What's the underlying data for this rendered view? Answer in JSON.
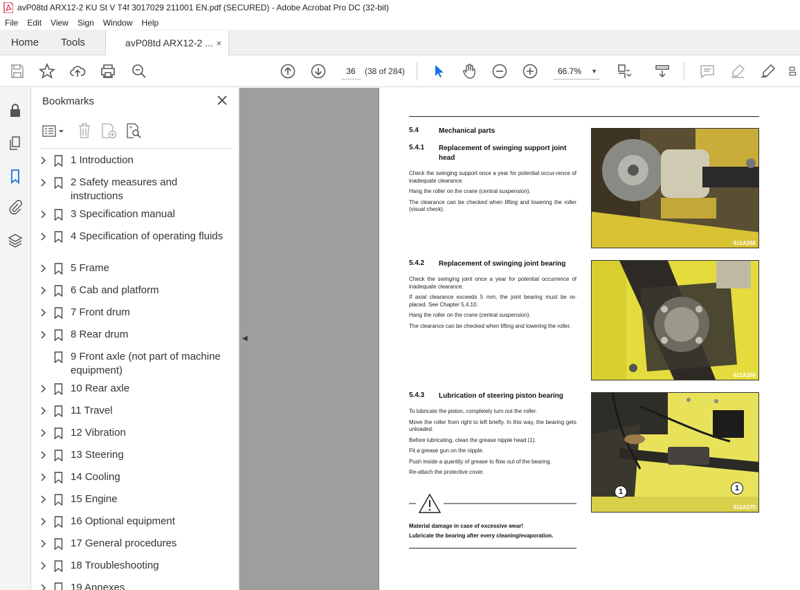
{
  "window": {
    "title": "avP08td ARX12-2 KU St V T4f 3017029 211001 EN.pdf (SECURED) - Adobe Acrobat Pro DC (32-bit)"
  },
  "menu": [
    "File",
    "Edit",
    "View",
    "Sign",
    "Window",
    "Help"
  ],
  "tabs": {
    "home": "Home",
    "tools": "Tools",
    "document": "avP08td ARX12-2 ...",
    "close": "×"
  },
  "toolbar": {
    "page_value": "36",
    "page_count": "(38 of 284)",
    "zoom": "66.7%"
  },
  "bookmarks": {
    "title": "Bookmarks",
    "items": [
      {
        "label": "1 Introduction",
        "expandable": true
      },
      {
        "label": "2 Safety measures and instructions",
        "expandable": true
      },
      {
        "label": "3 Specification manual",
        "expandable": true
      },
      {
        "label": "4 Specification of operating fluids",
        "expandable": true
      },
      {
        "label": "5 Frame",
        "expandable": true
      },
      {
        "label": "6 Cab and platform",
        "expandable": true
      },
      {
        "label": "7 Front drum",
        "expandable": true
      },
      {
        "label": "8 Rear drum",
        "expandable": true
      },
      {
        "label": "9 Front axle (not part of machine equipment)",
        "expandable": false
      },
      {
        "label": "10 Rear axle",
        "expandable": true
      },
      {
        "label": "11 Travel",
        "expandable": true
      },
      {
        "label": "12 Vibration",
        "expandable": true
      },
      {
        "label": "13 Steering",
        "expandable": true
      },
      {
        "label": "14 Cooling",
        "expandable": true
      },
      {
        "label": "15 Engine",
        "expandable": true
      },
      {
        "label": "16 Optional equipment",
        "expandable": true
      },
      {
        "label": "17 General procedures",
        "expandable": true
      },
      {
        "label": "18 Troubleshooting",
        "expandable": true
      },
      {
        "label": "19 Annexes",
        "expandable": true
      }
    ]
  },
  "document": {
    "sections": [
      {
        "num": "5.4",
        "title": "Mechanical parts"
      },
      {
        "num": "5.4.1",
        "title": "Replacement of swinging support joint head"
      },
      {
        "num": "5.4.2",
        "title": "Replacement of swinging joint bearing"
      },
      {
        "num": "5.4.3",
        "title": "Lubrication of steering piston bearing"
      }
    ],
    "text_541": [
      "Check the swinging support once a year for potential occur-rence of inadequate clearance.",
      "Hang the roller on the crane (central suspension).",
      "The clearance can be checked when lifting and lowering the roller (visual check)."
    ],
    "text_542": [
      "Check the swinging joint once a year for potential occurrence of inadequate clearance.",
      "If axial clearance exceeds 5 mm, the joint bearing must be re-placed. See Chapter 5.4.10.",
      "Hang the roller on the crane (central suspension).",
      "The clearance can be checked when lifting and lowering the roller."
    ],
    "text_543": [
      "To lubricate the piston, completely turn out the roller.",
      "Move the roller from right to left briefly. In this way, the bearing gets unloaded.",
      "Before lubricating, clean the grease nipple head (1).",
      "Fit a grease gun on the nipple.",
      "Push inside a quantity of grease to flow out of the bearing.",
      "Re-attach the protective cover."
    ],
    "warning": {
      "line1": "Material damage in case of excessive wear!",
      "line2": "Lubricate the bearing after every cleaning/evaporation."
    },
    "figures": [
      {
        "caption": "611A268"
      },
      {
        "caption": "611A269"
      },
      {
        "caption": "611A270",
        "callout_left": "1",
        "callout_right": "1"
      }
    ]
  }
}
